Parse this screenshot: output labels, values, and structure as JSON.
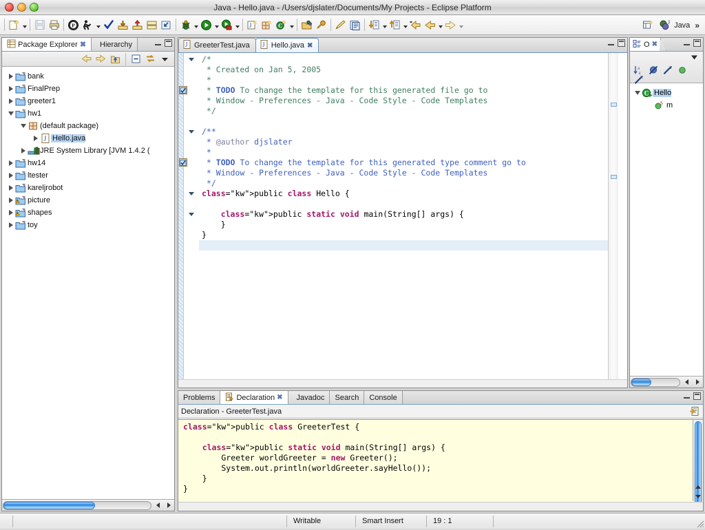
{
  "window": {
    "title": "Java - Hello.java - /Users/djslater/Documents/My Projects - Eclipse Platform",
    "close_label": "Close",
    "minimize_label": "Minimize",
    "zoom_label": "Zoom"
  },
  "toolbar": {
    "items": [
      {
        "name": "new-wizard-icon",
        "label": "New"
      },
      {
        "name": "save-icon",
        "label": "Save"
      },
      {
        "name": "print-icon",
        "label": "Print"
      },
      {
        "name": "open-type-icon",
        "label": "Open Type"
      },
      {
        "name": "build-icon",
        "label": "Build"
      },
      {
        "name": "check-icon",
        "label": "Validate"
      },
      {
        "name": "import-icon",
        "label": "Import"
      },
      {
        "name": "export-icon",
        "label": "Export"
      },
      {
        "name": "drawer-icon",
        "label": "Drawer"
      },
      {
        "name": "extract-icon",
        "label": "Extract"
      },
      {
        "name": "debug-icon",
        "label": "Debug"
      },
      {
        "name": "run-icon",
        "label": "Run"
      },
      {
        "name": "run-external-icon",
        "label": "External Tools"
      },
      {
        "name": "new-java-project-icon",
        "label": "New Java Project"
      },
      {
        "name": "new-package-icon",
        "label": "New Package"
      },
      {
        "name": "new-class-icon",
        "label": "New Class"
      },
      {
        "name": "open-resource-icon",
        "label": "Open Resource"
      },
      {
        "name": "search-icon",
        "label": "Search"
      },
      {
        "name": "pencil-icon",
        "label": "Annotation"
      },
      {
        "name": "toggle-markers-icon",
        "label": "Toggle Markers"
      },
      {
        "name": "next-member-icon",
        "label": "Next Member"
      },
      {
        "name": "previous-member-icon",
        "label": "Previous Member"
      },
      {
        "name": "back-last-edit-icon",
        "label": "Last Edit Location"
      },
      {
        "name": "back-icon",
        "label": "Back"
      },
      {
        "name": "forward-icon",
        "label": "Forward"
      }
    ],
    "perspective": {
      "open_perspective_label": "Open Perspective",
      "current_label": "Java",
      "overflow_label": "»"
    }
  },
  "package_explorer": {
    "tabs": [
      {
        "label": "Package Explorer",
        "active": true,
        "closable": true
      },
      {
        "label": "Hierarchy",
        "active": false,
        "closable": false
      }
    ],
    "toolbar": [
      {
        "name": "back-icon",
        "label": "Back"
      },
      {
        "name": "forward-icon",
        "label": "Forward"
      },
      {
        "name": "up-icon",
        "label": "Up"
      },
      {
        "name": "collapse-all-icon",
        "label": "Collapse All"
      },
      {
        "name": "link-with-editor-icon",
        "label": "Link with Editor"
      },
      {
        "name": "view-menu-icon",
        "label": "View Menu"
      }
    ],
    "tree": [
      {
        "label": "bank",
        "icon": "project-folder-icon",
        "indent": 0,
        "state": "closed",
        "selected": false
      },
      {
        "label": "FinalPrep",
        "icon": "project-folder-icon",
        "indent": 0,
        "state": "closed",
        "selected": false
      },
      {
        "label": "greeter1",
        "icon": "project-folder-icon",
        "indent": 0,
        "state": "closed",
        "selected": false
      },
      {
        "label": "hw1",
        "icon": "project-folder-icon",
        "indent": 0,
        "state": "open",
        "selected": false
      },
      {
        "label": "(default package)",
        "icon": "package-icon",
        "indent": 1,
        "state": "open",
        "selected": false
      },
      {
        "label": "Hello.java",
        "icon": "java-file-icon",
        "indent": 2,
        "state": "closed",
        "selected": true
      },
      {
        "label": "JRE System Library [JVM 1.4.2 (",
        "icon": "library-icon",
        "indent": 1,
        "state": "closed",
        "selected": false
      },
      {
        "label": "hw14",
        "icon": "project-folder-icon",
        "indent": 0,
        "state": "closed",
        "selected": false
      },
      {
        "label": "ltester",
        "icon": "project-folder-icon",
        "indent": 0,
        "state": "closed",
        "selected": false
      },
      {
        "label": "kareljrobot",
        "icon": "project-folder-icon",
        "indent": 0,
        "state": "closed",
        "selected": false
      },
      {
        "label": "picture",
        "icon": "project-folder-warning-icon",
        "indent": 0,
        "state": "closed",
        "selected": false
      },
      {
        "label": "shapes",
        "icon": "project-folder-warning-icon",
        "indent": 0,
        "state": "closed",
        "selected": false
      },
      {
        "label": "toy",
        "icon": "project-folder-icon",
        "indent": 0,
        "state": "closed",
        "selected": false
      }
    ]
  },
  "editor": {
    "tabs": [
      {
        "label": "GreeterTest.java",
        "active": false,
        "closable": false
      },
      {
        "label": "Hello.java",
        "active": true,
        "closable": true
      }
    ],
    "lines": [
      {
        "text": "/*",
        "style": "comment",
        "fold": true
      },
      {
        "text": " * Created on Jan 5, 2005",
        "style": "comment"
      },
      {
        "text": " *",
        "style": "comment"
      },
      {
        "text": " * TODO To change the template for this generated file go to",
        "style": "comment-todo",
        "todo": "TODO",
        "marker": true
      },
      {
        "text": " * Window - Preferences - Java - Code Style - Code Templates",
        "style": "comment"
      },
      {
        "text": " */",
        "style": "comment"
      },
      {
        "text": "",
        "style": "plain"
      },
      {
        "text": "/**",
        "style": "javadoc",
        "fold": true
      },
      {
        "text": " * @author djslater",
        "style": "javadoc-tag",
        "tag": "@author"
      },
      {
        "text": " *",
        "style": "javadoc"
      },
      {
        "text": " * TODO To change the template for this generated type comment go to",
        "style": "javadoc-todo",
        "todo": "TODO",
        "marker": true
      },
      {
        "text": " * Window - Preferences - Java - Code Style - Code Templates",
        "style": "javadoc"
      },
      {
        "text": " */",
        "style": "javadoc"
      },
      {
        "text": "public class Hello {",
        "style": "code",
        "fold": true
      },
      {
        "text": "",
        "style": "plain"
      },
      {
        "text": "    public static void main(String[] args) {",
        "style": "code",
        "fold": true
      },
      {
        "text": "    }",
        "style": "code"
      },
      {
        "text": "}",
        "style": "code"
      },
      {
        "text": "",
        "style": "plain",
        "highlight": true
      }
    ]
  },
  "outline": {
    "tabs": [
      {
        "label": "O",
        "active": true,
        "closable": true
      }
    ],
    "toolbar": [
      {
        "name": "sort-icon",
        "label": "Sort"
      },
      {
        "name": "hide-fields-icon",
        "label": "Hide Fields"
      },
      {
        "name": "hide-static-icon",
        "label": "Hide Static Fields and Methods"
      },
      {
        "name": "hide-public-icon",
        "label": "Hide Non-Public Members"
      },
      {
        "name": "hide-local-types-icon",
        "label": "Hide Local Types"
      },
      {
        "name": "view-menu-icon",
        "label": "View Menu"
      }
    ],
    "tree": [
      {
        "label": "Hello",
        "icon": "java-class-icon",
        "indent": 0,
        "state": "open",
        "selected": true
      },
      {
        "label": "m",
        "icon": "public-method-static-icon",
        "indent": 1,
        "state": "leaf",
        "selected": false
      }
    ]
  },
  "bottom_panel": {
    "tabs": [
      {
        "label": "Problems",
        "active": false,
        "closable": false
      },
      {
        "label": "Declaration",
        "active": true,
        "closable": true
      },
      {
        "label": "Javadoc",
        "active": false,
        "closable": false
      },
      {
        "label": "Search",
        "active": false,
        "closable": false
      },
      {
        "label": "Console",
        "active": false,
        "closable": false
      }
    ],
    "title": "Declaration - GreeterTest.java",
    "toolbar": [
      {
        "name": "open-declaration-icon",
        "label": "Open Input"
      }
    ],
    "code_lines": [
      {
        "text": "public class GreeterTest {",
        "style": "code"
      },
      {
        "text": "",
        "style": "plain"
      },
      {
        "text": "    public static void main(String[] args) {",
        "style": "code"
      },
      {
        "text": "        Greeter worldGreeter = new Greeter();",
        "style": "code"
      },
      {
        "text": "        System.out.println(worldGreeter.sayHello());",
        "style": "code"
      },
      {
        "text": "    }",
        "style": "code"
      },
      {
        "text": "}",
        "style": "code"
      }
    ]
  },
  "status_bar": {
    "writable": "Writable",
    "insert_mode": "Smart Insert",
    "position": "19 : 1"
  },
  "colors": {
    "keyword": "#a2186b",
    "comment": "#3f7f5f",
    "javadoc": "#3f5fbf",
    "selection": "#b6d5f3",
    "declaration_bg": "#ffffe0",
    "scrollbar_blue": "#1f7fe0"
  }
}
